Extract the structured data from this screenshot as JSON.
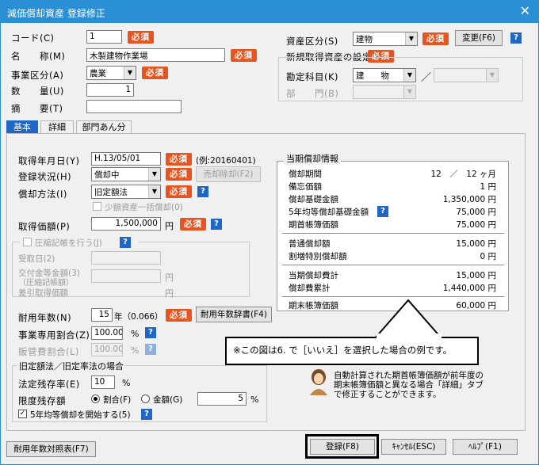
{
  "window": {
    "title": "減価償却資産 登録修正",
    "close": "✕"
  },
  "required_badge": "必須",
  "help_glyph": "?",
  "header": {
    "code": {
      "label": "コード(C)",
      "value": "1"
    },
    "name": {
      "label": "名　　称(M)",
      "value": "木製建物作業場"
    },
    "business": {
      "label": "事業区分(A)",
      "value": "農業"
    },
    "quantity": {
      "label": "数　　量(U)",
      "value": "1"
    },
    "summary": {
      "label": "摘　　要(T)",
      "value": ""
    },
    "asset_class": {
      "label": "資産区分(S)",
      "value": "建物",
      "change_button": "変更(F6)"
    },
    "new_acq": {
      "title": "新規取得資産の設定",
      "account_label": "勘定科目(K)",
      "account_value": "建　　物",
      "slash": "／",
      "dept_label": "部　　門(B)"
    }
  },
  "tabs": [
    {
      "label": "基本"
    },
    {
      "label": "詳細"
    },
    {
      "label": "部門あん分"
    }
  ],
  "basic": {
    "acq_date": {
      "label": "取得年月日(Y)",
      "value": "H.13/05/01",
      "example": "(例:20160401)"
    },
    "reg_status": {
      "label": "登録状況(H)",
      "value": "償却中",
      "sale_button": "売却除却(F2)"
    },
    "method": {
      "label": "償却方法(I)",
      "value": "旧定額法",
      "small_amount": "少額資産一括償却(0)"
    },
    "acq_price": {
      "label": "取得価額(P)",
      "value": "1,500,000",
      "unit": "円"
    },
    "compression": {
      "label": "圧縮記帳を行う(J)",
      "receipt_date": "受取日(2)",
      "subsidy": "交付金等金額(3)",
      "subsidy_sub": "（圧縮記帳額）",
      "diff_price": "差引取得価額",
      "unit": "円"
    },
    "useful_life": {
      "label": "耐用年数(N)",
      "value": "15",
      "rate_text": "年（0.066）",
      "dict_button": "耐用年数辞書(F4)"
    },
    "biz_ratio": {
      "label": "事業専用割合(Z)",
      "value": "100.00",
      "unit": "%"
    },
    "sales_ratio": {
      "label": "販管費割合(L)",
      "value": "100.00",
      "unit": "%"
    },
    "old_group": {
      "title": "旧定額法／旧定率法の場合",
      "fixed_rate_label": "法定残存率(E)",
      "fixed_rate_value": "10",
      "fixed_rate_unit": "%",
      "limit_label": "限度残存額",
      "radio_ratio": "割合(F)",
      "radio_amount": "金額(G)",
      "amount_value": "5",
      "amount_unit": "%",
      "five_year": "5年均等償却を開始する(5)"
    }
  },
  "depreciation_info": {
    "title": "当期償却情報",
    "period": {
      "label": "償却期間",
      "value": "12　／　12 ヶ月"
    },
    "memo": {
      "label": "備忘価額",
      "value": "1 円"
    },
    "base": {
      "label": "償却基礎金額",
      "value": "1,350,000 円"
    },
    "five_year_base": {
      "label": "5年均等償却基礎金額",
      "value": "75,000 円"
    },
    "opening_book": {
      "label": "期首帳簿価額",
      "value": "75,000 円"
    },
    "normal": {
      "label": "普通償却額",
      "value": "15,000 円"
    },
    "special": {
      "label": "割増特別償却額",
      "value": "0 円"
    },
    "current_total": {
      "label": "当期償却費計",
      "value": "15,000 円"
    },
    "accumulated": {
      "label": "償却費累計",
      "value": "1,440,000 円"
    },
    "closing_book": {
      "label": "期末帳簿価額",
      "value": "60,000 円"
    }
  },
  "callout": "※この図は6. で［いいえ］を選択した場合の例です。",
  "tip": {
    "text_line1": "自動計算された期首帳簿価額が前年度の",
    "text_line2": "期末帳簿価額と異なる場合「詳細」タブ",
    "text_line3": "で修正することができます。"
  },
  "footer": {
    "table_button": "耐用年数対照表(F7)",
    "register": "登録(F8)",
    "cancel": "ｷｬﾝｾﾙ(ESC)",
    "help": "ﾍﾙﾌﾟ(F1)"
  }
}
